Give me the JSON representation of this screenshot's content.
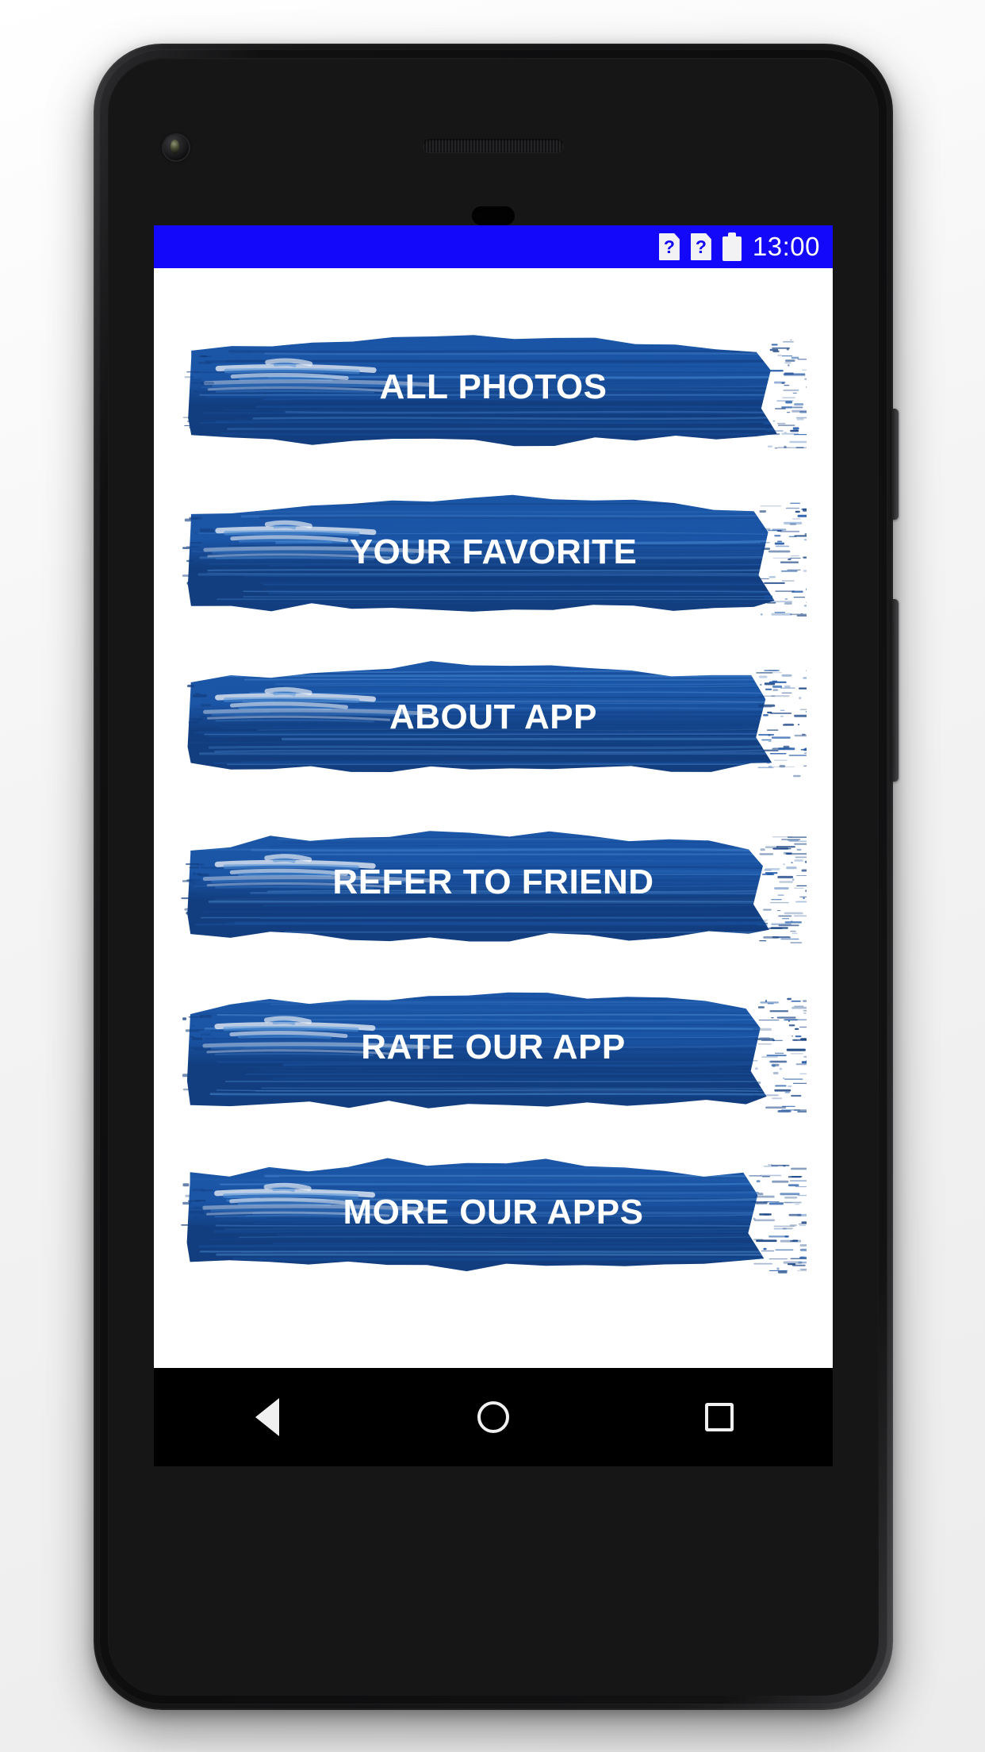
{
  "device": {
    "kind": "android-phone-mockup",
    "frame_color": "#161617",
    "screen_bg": "#ffffff"
  },
  "status_bar": {
    "background_color": "#1408FB",
    "text_color": "#FFFFFF",
    "clock": "13:00",
    "icons": [
      {
        "name": "unknown-status-icon-1",
        "glyph": "?"
      },
      {
        "name": "unknown-status-icon-2",
        "glyph": "?"
      },
      {
        "name": "battery-icon",
        "glyph": ""
      }
    ]
  },
  "app": {
    "accent_color": "#1B4F9C",
    "brush_dark": "#123E80",
    "brush_mid": "#1B55A6",
    "brush_light": "#4E8FD6",
    "menu": [
      {
        "id": "all-photos",
        "label": "ALL PHOTOS"
      },
      {
        "id": "your-favorite",
        "label": "YOUR FAVORITE"
      },
      {
        "id": "about-app",
        "label": "ABOUT APP"
      },
      {
        "id": "refer-to-friend",
        "label": "REFER TO FRIEND"
      },
      {
        "id": "rate-our-app",
        "label": "RATE OUR APP"
      },
      {
        "id": "more-our-apps",
        "label": "MORE OUR APPS"
      }
    ]
  },
  "nav_bar": {
    "background_color": "#000000",
    "buttons": [
      {
        "id": "back",
        "icon": "back-triangle-icon"
      },
      {
        "id": "home",
        "icon": "home-circle-icon"
      },
      {
        "id": "recents",
        "icon": "recents-square-icon"
      }
    ]
  }
}
